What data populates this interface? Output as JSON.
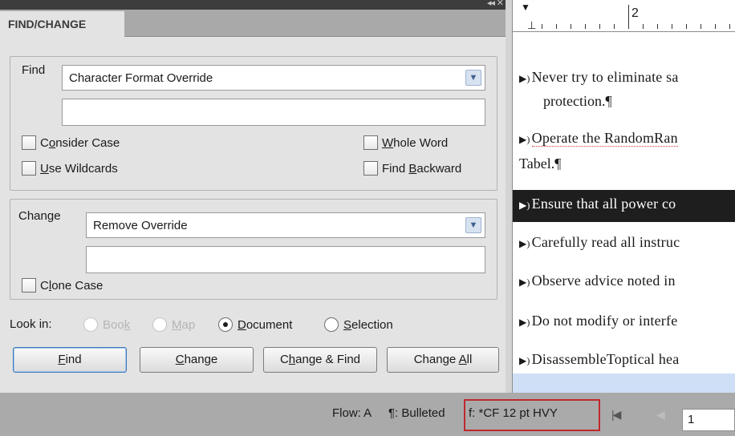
{
  "panel": {
    "collapse_glyph": "◂◂",
    "close_glyph": "✕",
    "tab_title": "FIND/CHANGE"
  },
  "find": {
    "label": "Find",
    "dropdown_value": "Character Format Override",
    "text_value": "",
    "options": [
      {
        "pre": "C",
        "accel": "o",
        "post": "nsider Case"
      },
      {
        "pre": "",
        "accel": "W",
        "post": "hole Word"
      },
      {
        "pre": "",
        "accel": "U",
        "post": "se Wildcards"
      },
      {
        "pre": "Find ",
        "accel": "B",
        "post": "ackward"
      }
    ]
  },
  "change": {
    "label": "Change",
    "dropdown_value": "Remove Override",
    "text_value": "",
    "clone_case": {
      "pre": "C",
      "accel": "l",
      "post": "one Case"
    }
  },
  "look_in": {
    "label": "Look in:",
    "book": {
      "pre": "Boo",
      "accel": "k",
      "post": ""
    },
    "map": {
      "pre": "",
      "accel": "M",
      "post": "ap"
    },
    "document": {
      "pre": "",
      "accel": "D",
      "post": "ocument"
    },
    "selection": {
      "pre": "",
      "accel": "S",
      "post": "election"
    }
  },
  "buttons": {
    "find": {
      "pre": "",
      "accel": "F",
      "post": "ind"
    },
    "change": {
      "pre": "",
      "accel": "C",
      "post": "hange"
    },
    "change_find": {
      "pre": "C",
      "accel": "h",
      "post": "ange & Find"
    },
    "change_all": {
      "pre": "Change ",
      "accel": "A",
      "post": "ll"
    }
  },
  "status_bar": {
    "flow": "Flow: A",
    "para_style": "¶: Bulleted",
    "char_format": "f: *CF 12 pt HVY",
    "first_page_glyph": "|◀",
    "prev_page_glyph": "◀",
    "page_number": "1"
  },
  "document": {
    "ruler_number": "2",
    "paragraphs": [
      {
        "text": "Never try to eliminate sa",
        "cont": "protection.¶"
      },
      {
        "text": "Operate the RandomRan",
        "cont": "Tabel.¶"
      },
      {
        "text": "Ensure that all power co",
        "cont": ""
      },
      {
        "text": "Carefully read all instruc",
        "cont": ""
      },
      {
        "text": "Observe advice noted in",
        "cont": ""
      },
      {
        "text": "Do not modify or interfe",
        "cont": ""
      },
      {
        "text": "DisassembleToptical hea",
        "cont": ""
      }
    ],
    "bullet_glyph": "▶)"
  },
  "colors": {
    "highlight_border": "#c0282d",
    "panel_bg": "#e3e3e3",
    "selection_bg": "#1e1e1e"
  }
}
